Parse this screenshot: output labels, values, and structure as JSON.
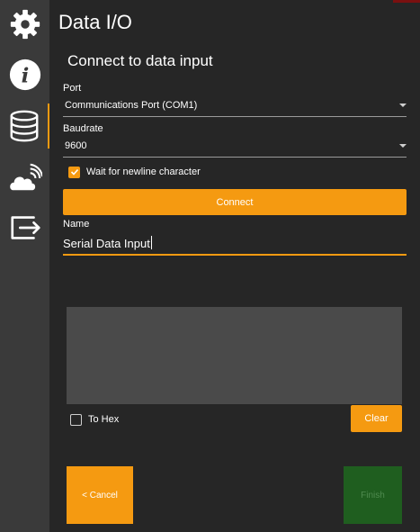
{
  "app": {
    "title": "Data I/O"
  },
  "page": {
    "subtitle": "Connect to data input"
  },
  "sidebar": {
    "items": [
      {
        "name": "settings",
        "icon": "gear-icon"
      },
      {
        "name": "info",
        "icon": "info-icon"
      },
      {
        "name": "data",
        "icon": "database-icon",
        "active": true
      },
      {
        "name": "cloud",
        "icon": "cloud-signal-icon"
      },
      {
        "name": "export",
        "icon": "export-icon"
      }
    ]
  },
  "form": {
    "port": {
      "label": "Port",
      "value": "Communications Port (COM1)"
    },
    "baudrate": {
      "label": "Baudrate",
      "value": "9600"
    },
    "wait_newline": {
      "label": "Wait for newline character",
      "checked": true
    },
    "connect_label": "Connect",
    "name": {
      "label": "Name",
      "value": "Serial Data Input"
    }
  },
  "output": {
    "to_hex": {
      "label": "To Hex",
      "checked": false
    },
    "clear_label": "Clear"
  },
  "footer": {
    "cancel_label": "< Cancel",
    "finish_label": "Finish"
  },
  "colors": {
    "accent": "#f59a11",
    "finish_bg": "#1f5e1f",
    "background": "#262626",
    "sidebar": "#3a3a3a"
  }
}
